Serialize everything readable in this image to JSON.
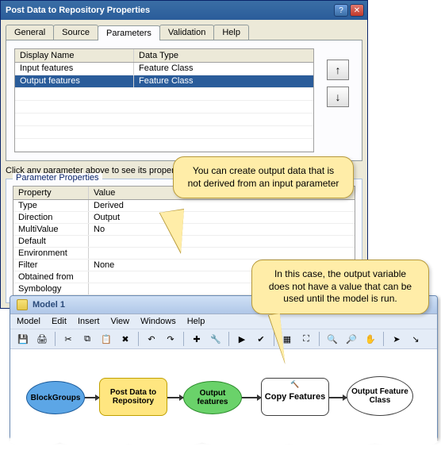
{
  "dialog": {
    "title": "Post Data to Repository Properties",
    "tabs": [
      "General",
      "Source",
      "Parameters",
      "Validation",
      "Help"
    ],
    "active_tab": 2,
    "param_headers": {
      "dn": "Display Name",
      "dt": "Data Type"
    },
    "param_rows": [
      {
        "dn": "Input features",
        "dt": "Feature Class",
        "sel": false
      },
      {
        "dn": "Output features",
        "dt": "Feature Class",
        "sel": true
      }
    ],
    "hint": "Click any parameter above to see its properties below.",
    "propbox_title": "Parameter Properties",
    "prop_headers": {
      "p": "Property",
      "v": "Value"
    },
    "prop_rows": [
      {
        "p": "Type",
        "v": "Derived"
      },
      {
        "p": "Direction",
        "v": "Output"
      },
      {
        "p": "MultiValue",
        "v": "No"
      },
      {
        "p": "Default",
        "v": ""
      },
      {
        "p": "Environment",
        "v": ""
      },
      {
        "p": "Filter",
        "v": "None"
      },
      {
        "p": "Obtained from",
        "v": ""
      },
      {
        "p": "Symbology",
        "v": ""
      }
    ]
  },
  "model": {
    "title": "Model 1",
    "menus": [
      "Model",
      "Edit",
      "Insert",
      "View",
      "Windows",
      "Help"
    ],
    "tools": [
      "save-icon",
      "print-icon",
      "|",
      "cut-icon",
      "copy-icon",
      "paste-icon",
      "delete-icon",
      "|",
      "undo-icon",
      "redo-icon",
      "|",
      "add-data-icon",
      "add-tool-icon",
      "|",
      "run-icon",
      "validate-icon",
      "|",
      "auto-layout-icon",
      "full-extent-icon",
      "|",
      "zoom-in-icon",
      "zoom-out-icon",
      "pan-icon",
      "|",
      "select-icon",
      "connect-icon"
    ],
    "shapes": {
      "blockgroups": "BlockGroups",
      "postdata": "Post Data to Repository",
      "outfeat": "Output features",
      "copyfn": "Copy Features",
      "outclass": "Output Feature Class"
    }
  },
  "callouts": {
    "c1": "You can create output data that is not derived from an input parameter",
    "c2": "In this case, the output variable does not have a value that can be used until the model is run."
  },
  "glyph": {
    "up": "↑",
    "down": "↓",
    "help": "?",
    "close": "✕",
    "dots": "…",
    "save-icon": "💾",
    "print-icon": "🖨",
    "cut-icon": "✂",
    "copy-icon": "⧉",
    "paste-icon": "📋",
    "delete-icon": "✖",
    "undo-icon": "↶",
    "redo-icon": "↷",
    "add-data-icon": "✚",
    "add-tool-icon": "🔧",
    "run-icon": "▶",
    "validate-icon": "✔",
    "auto-layout-icon": "▦",
    "full-extent-icon": "⛶",
    "zoom-in-icon": "🔍",
    "zoom-out-icon": "🔎",
    "pan-icon": "✋",
    "select-icon": "➤",
    "connect-icon": "↘",
    "hammer": "🔨"
  }
}
